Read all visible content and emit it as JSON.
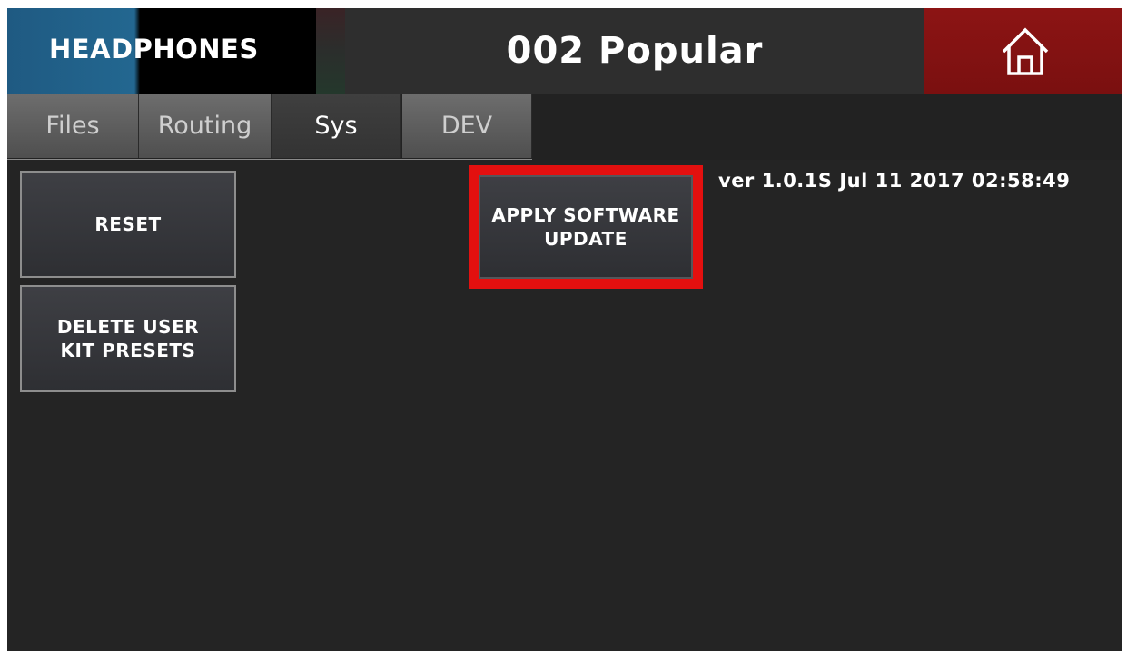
{
  "header": {
    "output_label": "HEADPHONES",
    "kit_name": "002 Popular",
    "home_icon": "home-icon"
  },
  "tabs": [
    {
      "label": "Files",
      "active": false
    },
    {
      "label": "Routing",
      "active": false
    },
    {
      "label": "Sys",
      "active": true
    },
    {
      "label": "DEV",
      "active": false
    }
  ],
  "sys_panel": {
    "reset_label": "RESET",
    "delete_presets_label": "DELETE USER\nKIT PRESETS",
    "apply_update_label": "APPLY SOFTWARE\nUPDATE",
    "version_text": "ver 1.0.1S Jul 11 2017 02:58:49"
  },
  "colors": {
    "home_button": "#8c1414",
    "highlight": "#e3100f",
    "output_label_blue": "#236790"
  }
}
